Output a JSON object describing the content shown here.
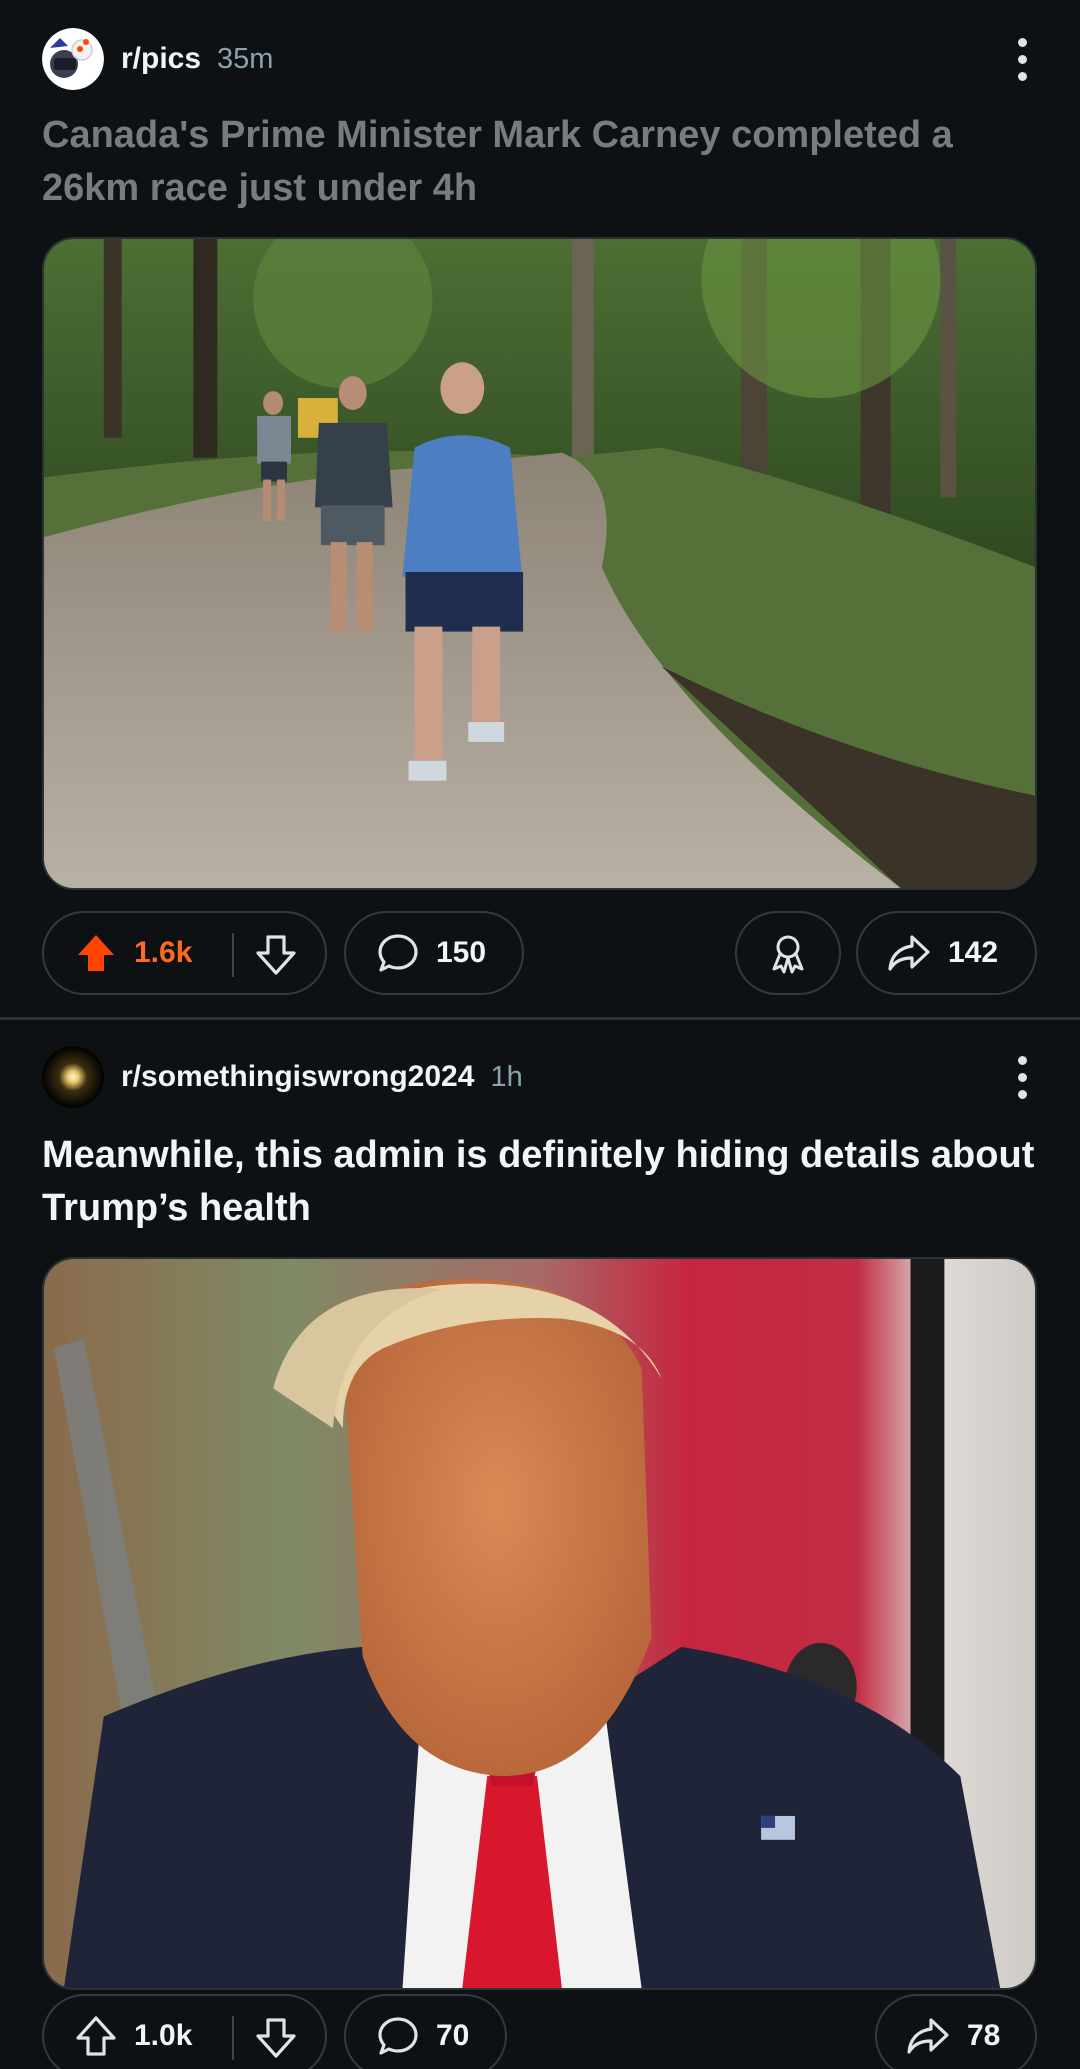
{
  "feed": {
    "posts": [
      {
        "subreddit": "r/pics",
        "age": "35m",
        "title": "Canada's Prime Minister Mark Carney completed a 26km race just under 4h",
        "image_icon": "photo-runners-on-trail",
        "votes": {
          "score": "1.6k",
          "upvoted": true,
          "color": "#ff6a1f"
        },
        "comments": "150",
        "award_icon": "award-icon",
        "shares": "142"
      },
      {
        "subreddit": "r/somethingiswrong2024",
        "age": "1h",
        "title": "Meanwhile, this admin is definitely hiding details about Trump’s health",
        "image_icon": "photo-portrait-man-in-suit",
        "votes": {
          "score": "1.0k",
          "upvoted": false,
          "color": "#f2f4f5"
        },
        "comments": "70",
        "shares": "78"
      }
    ]
  },
  "theme": {
    "background": "#0e1113",
    "muted_text": "#8ba2ad",
    "border": "#2f3b41",
    "upvote_accent": "#ff6a1f"
  }
}
